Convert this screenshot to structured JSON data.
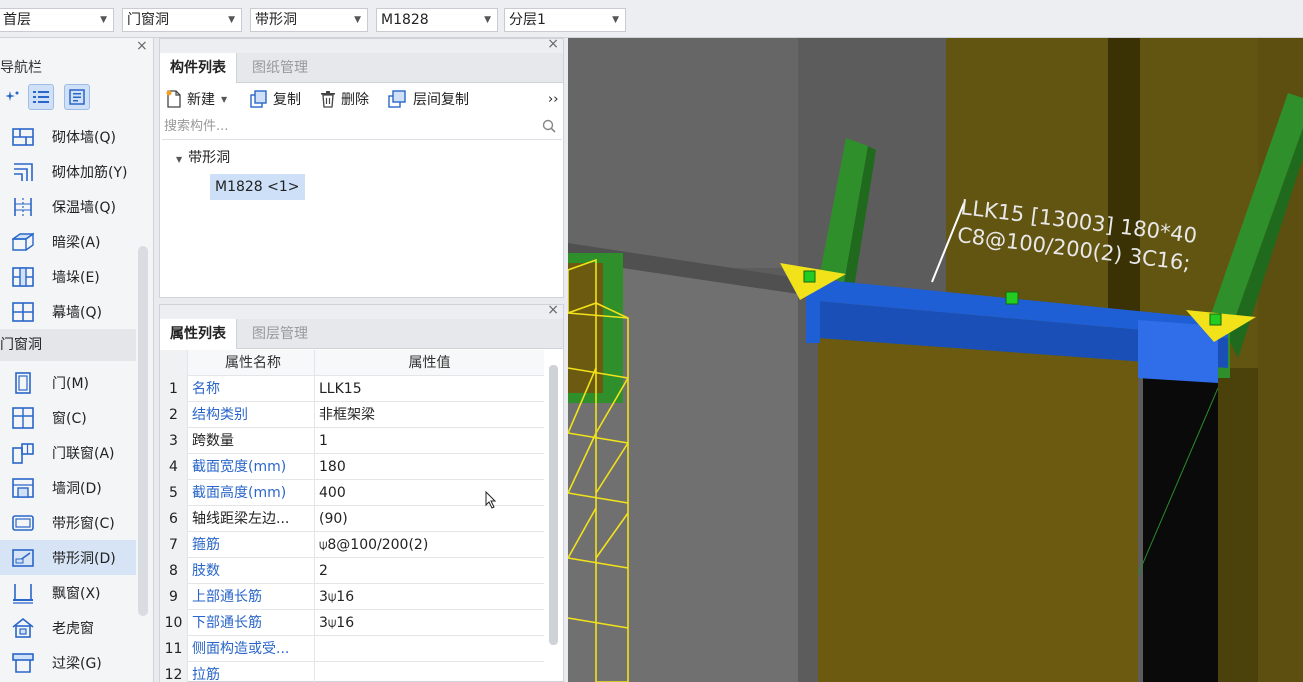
{
  "toolbar_dropdowns": [
    {
      "value": "首层"
    },
    {
      "value": "门窗洞"
    },
    {
      "value": "带形洞"
    },
    {
      "value": "M1828"
    },
    {
      "value": "分层1"
    }
  ],
  "nav": {
    "title": "导航栏",
    "items_top": [
      {
        "label": "砌体墙(Q)",
        "icon": "brick-wall-icon"
      },
      {
        "label": "砌体加筋(Y)",
        "icon": "wall-rebar-icon"
      },
      {
        "label": "保温墙(Q)",
        "icon": "insulation-wall-icon"
      },
      {
        "label": "暗梁(A)",
        "icon": "hidden-beam-icon"
      },
      {
        "label": "墙垛(E)",
        "icon": "wall-pier-icon"
      },
      {
        "label": "幕墙(Q)",
        "icon": "curtain-wall-icon"
      }
    ],
    "group": "门窗洞",
    "items_group": [
      {
        "label": "门(M)",
        "icon": "door-icon"
      },
      {
        "label": "窗(C)",
        "icon": "window-icon"
      },
      {
        "label": "门联窗(A)",
        "icon": "door-window-icon"
      },
      {
        "label": "墙洞(D)",
        "icon": "wall-hole-icon"
      },
      {
        "label": "带形窗(C)",
        "icon": "strip-window-icon"
      },
      {
        "label": "带形洞(D)",
        "icon": "strip-hole-icon"
      },
      {
        "label": "飘窗(X)",
        "icon": "bay-window-icon"
      },
      {
        "label": "老虎窗",
        "icon": "dormer-window-icon"
      },
      {
        "label": "过梁(G)",
        "icon": "lintel-icon"
      }
    ]
  },
  "component_panel": {
    "tabs": [
      "构件列表",
      "图纸管理"
    ],
    "toolbar": {
      "new": "新建",
      "copy": "复制",
      "delete": "删除",
      "floor_copy": "层间复制",
      "more": "››"
    },
    "search_placeholder": "搜索构件...",
    "tree": {
      "root": "带形洞",
      "leaf": "M1828 <1>"
    }
  },
  "property_panel": {
    "tabs": [
      "属性列表",
      "图层管理"
    ],
    "header": {
      "name": "属性名称",
      "value": "属性值"
    },
    "rows": [
      {
        "num": "1",
        "name": "名称",
        "value": "LLK15",
        "blue": true
      },
      {
        "num": "2",
        "name": "结构类别",
        "value": "非框架梁",
        "blue": true
      },
      {
        "num": "3",
        "name": "跨数量",
        "value": "1",
        "blue": false
      },
      {
        "num": "4",
        "name": "截面宽度(mm)",
        "value": "180",
        "blue": true
      },
      {
        "num": "5",
        "name": "截面高度(mm)",
        "value": "400",
        "blue": true
      },
      {
        "num": "6",
        "name": "轴线距梁左边...",
        "value": "(90)",
        "blue": false
      },
      {
        "num": "7",
        "name": "箍筋",
        "value": "⍦8@100/200(2)",
        "blue": true
      },
      {
        "num": "8",
        "name": "肢数",
        "value": "2",
        "blue": true
      },
      {
        "num": "9",
        "name": "上部通长筋",
        "value": "3⍦16",
        "blue": true
      },
      {
        "num": "10",
        "name": "下部通长筋",
        "value": "3⍦16",
        "blue": true
      },
      {
        "num": "11",
        "name": "侧面构造或受...",
        "value": "",
        "blue": true
      },
      {
        "num": "12",
        "name": "拉筋",
        "value": "",
        "blue": true
      }
    ]
  },
  "viewport": {
    "label_line1": "LLK15 [13003] 180*40",
    "label_line2": "C8@100/200(2) 3C16;",
    "colors": {
      "wall": "#6b5a10",
      "beam": "#1f5fd6",
      "column": "#2f8f2a",
      "marker": "#f2e21a",
      "bg": "#5e5e5e"
    }
  }
}
